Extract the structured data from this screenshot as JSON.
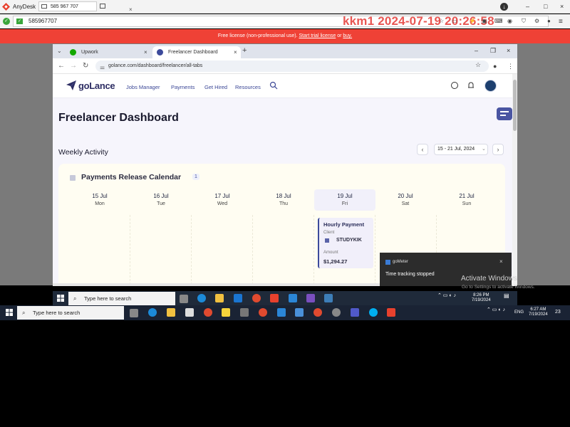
{
  "anydesk": {
    "title": "AnyDesk",
    "session_tab": "585 967 707",
    "address": "585967707",
    "watermark": "kkm1 2024-07-19 20:26:58",
    "license_prefix": "Free license (non-professional use).",
    "license_link1": "Start trial license",
    "license_or": "or",
    "license_link2": "buy."
  },
  "browser": {
    "tabs": [
      {
        "label": "Upwork",
        "active": false
      },
      {
        "label": "Freelancer Dashboard",
        "active": true
      }
    ],
    "url": "golance.com/dashboard/freelancer/all-tabs"
  },
  "site": {
    "brand": "goLance",
    "nav": [
      "Jobs Manager",
      "Payments",
      "Get Hired",
      "Resources"
    ]
  },
  "dashboard": {
    "title": "Freelancer Dashboard",
    "weekly_label": "Weekly Activity",
    "date_range": "15 - 21 Jul, 2024"
  },
  "calendar": {
    "title": "Payments Release Calendar",
    "count": "1",
    "days": [
      {
        "date": "15 Jul",
        "day": "Mon",
        "active": false
      },
      {
        "date": "16 Jul",
        "day": "Tue",
        "active": false
      },
      {
        "date": "17 Jul",
        "day": "Wed",
        "active": false
      },
      {
        "date": "18 Jul",
        "day": "Thu",
        "active": false
      },
      {
        "date": "19 Jul",
        "day": "Fri",
        "active": true
      },
      {
        "date": "20 Jul",
        "day": "Sat",
        "active": false
      },
      {
        "date": "21 Jul",
        "day": "Sun",
        "active": false
      }
    ],
    "payment": {
      "title": "Hourly Payment",
      "client_label": "Client",
      "client": "STUDYKIK",
      "amount_label": "Amount",
      "amount": "$1,294.27"
    }
  },
  "toast": {
    "app": "goMeter",
    "message": "Time tracking stopped"
  },
  "windows_notice": {
    "line1": "Activate Windows",
    "line2": "Go to Settings to activate Windows."
  },
  "remote_taskbar": {
    "search_placeholder": "Type here to search",
    "time": "8:26 PM",
    "date": "7/19/2024"
  },
  "local_taskbar": {
    "search_placeholder": "Type here to search",
    "lang": "ENG",
    "time": "6:27 AM",
    "date": "7/19/2024",
    "notif_count": "23"
  },
  "colors": {
    "license_bar": "#ef4136",
    "brand": "#2d2d63",
    "accent": "#3c4a9b"
  }
}
